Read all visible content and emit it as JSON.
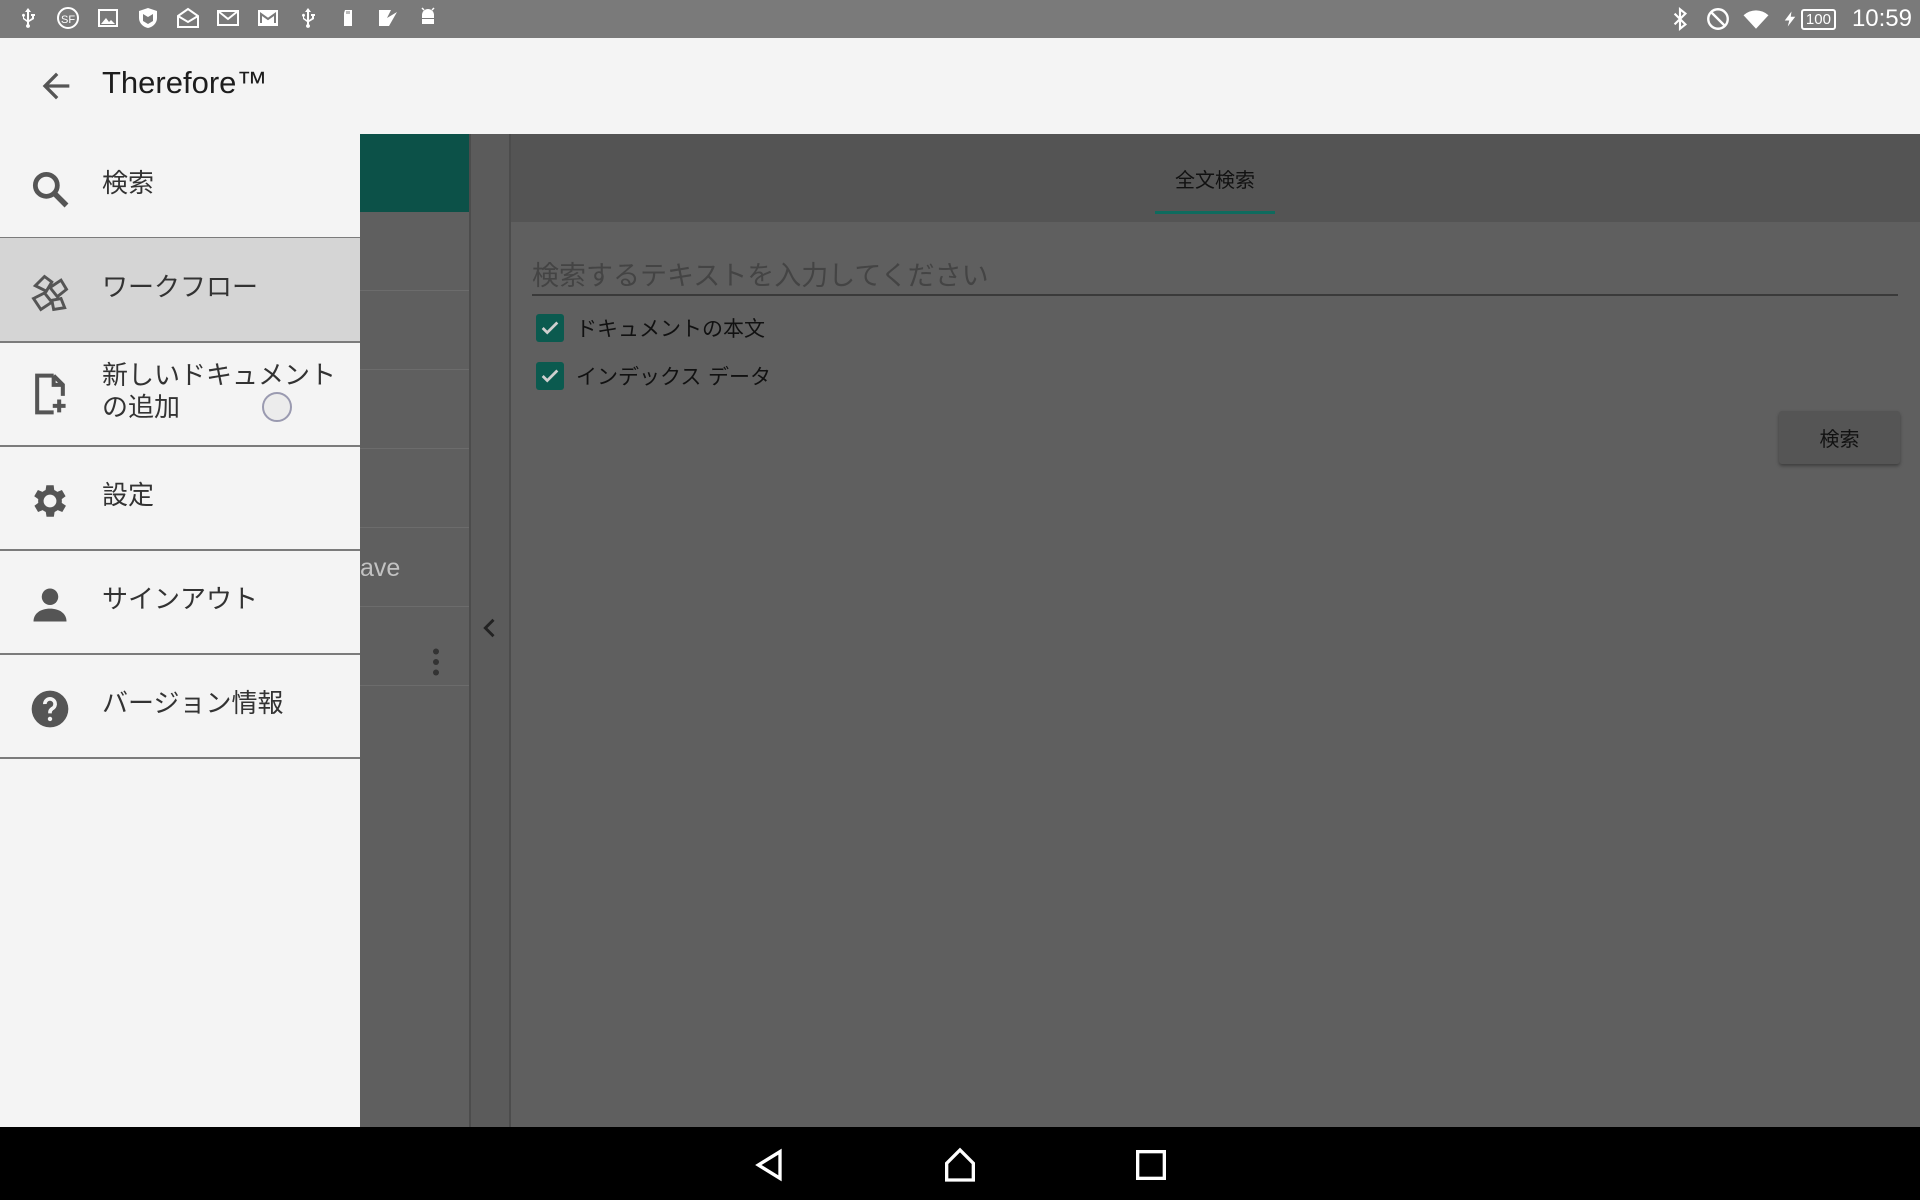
{
  "status_bar": {
    "left_icons": [
      "usb-icon",
      "sf-app-icon",
      "image-icon",
      "mcafee-icon",
      "mail-open-icon",
      "mail-icon",
      "gmail-icon",
      "usb-debug-icon",
      "sd-card-icon",
      "checkmark-app-icon",
      "android-debug-icon"
    ],
    "battery": "100",
    "time": "10:59"
  },
  "app_bar": {
    "title": "Therefore™"
  },
  "drawer": {
    "items": [
      {
        "label": "検索",
        "icon": "search-icon"
      },
      {
        "label": "ワークフロー",
        "icon": "workflow-icon"
      },
      {
        "label": "新しいドキュメント\nの追加",
        "icon": "add-document-icon"
      },
      {
        "label": "設定",
        "icon": "gear-icon"
      },
      {
        "label": "サインアウト",
        "icon": "person-icon"
      },
      {
        "label": "バージョン情報",
        "icon": "help-icon"
      }
    ]
  },
  "background": {
    "partial_list_text": "ave",
    "tab_label": "全文検索",
    "search_placeholder": "検索するテキストを入力してください",
    "checkbox_body": "ドキュメントの本文",
    "checkbox_index": "インデックス データ",
    "search_button": "検索"
  },
  "colors": {
    "accent": "#0b5a4f",
    "drawer_bg": "#f4f4f4",
    "active_item": "#d5d5d5"
  }
}
